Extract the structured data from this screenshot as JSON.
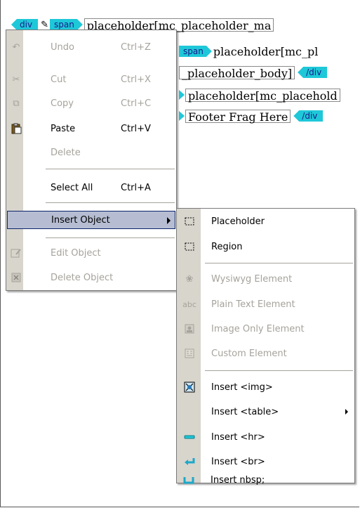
{
  "editor": {
    "line1": {
      "tag_div": "div",
      "tag_span": "span",
      "text": "placeholder[mc_placeholder_ma"
    },
    "line2": {
      "tag_span": "span",
      "text": "placeholder[mc_pl"
    },
    "line3": {
      "text": "_placeholder_body]",
      "tag_close": "/div"
    },
    "line4": {
      "text": "placeholder[mc_placehold"
    },
    "line5": {
      "text": "Footer Frag Here",
      "tag_close": "/div"
    }
  },
  "context_menu": {
    "items": {
      "undo": {
        "label": "Undo",
        "shortcut": "Ctrl+Z",
        "icon": "undo-icon"
      },
      "cut": {
        "label": "Cut",
        "shortcut": "Ctrl+X",
        "icon": "scissors-icon"
      },
      "copy": {
        "label": "Copy",
        "shortcut": "Ctrl+C",
        "icon": "copy-icon"
      },
      "paste": {
        "label": "Paste",
        "shortcut": "Ctrl+V",
        "icon": "clipboard-icon"
      },
      "delete": {
        "label": "Delete"
      },
      "select_all": {
        "label": "Select All",
        "shortcut": "Ctrl+A"
      },
      "insert_object": {
        "label": "Insert Object"
      },
      "edit_object": {
        "label": "Edit Object",
        "icon": "edit-object-icon"
      },
      "delete_object": {
        "label": "Delete Object",
        "icon": "delete-object-icon"
      }
    }
  },
  "submenu": {
    "items": {
      "placeholder": {
        "label": "Placeholder",
        "icon": "placeholder-icon"
      },
      "region": {
        "label": "Region",
        "icon": "region-icon"
      },
      "wysiwyg": {
        "label": "Wysiwyg Element",
        "icon": "wysiwyg-icon"
      },
      "plain_text": {
        "label": "Plain Text Element",
        "icon_text": "abc"
      },
      "image_only": {
        "label": "Image Only Element",
        "icon": "image-icon"
      },
      "custom": {
        "label": "Custom Element",
        "icon": "custom-element-icon"
      },
      "insert_img": {
        "label": "Insert <img>",
        "icon": "insert-image-icon"
      },
      "insert_table": {
        "label": "Insert <table>"
      },
      "insert_hr": {
        "label": "Insert <hr>",
        "icon": "horizontal-rule-icon"
      },
      "insert_br": {
        "label": "Insert <br>",
        "icon": "line-break-icon"
      },
      "insert_nbsp": {
        "label": "Insert nbsp;",
        "icon": "nbsp-icon"
      }
    }
  },
  "colors": {
    "tag_cyan": "#1ec8d8",
    "menu_gutter": "#d8d5cd",
    "highlight_bg": "#b6bdd2",
    "highlight_border": "#0a246a",
    "disabled_text": "#a6a39c"
  }
}
